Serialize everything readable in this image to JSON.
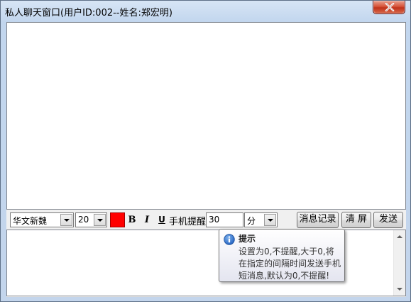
{
  "window": {
    "title": "私人聊天窗口(用户ID:002--姓名:郑宏明)",
    "close_icon": "close-icon"
  },
  "toolbar": {
    "font_family": "华文新魏",
    "font_size": "20",
    "text_color": "#ff0000",
    "bold_label": "B",
    "italic_label": "I",
    "underline_label": "U",
    "reminder_label": "手机提醒",
    "reminder_value": "30",
    "reminder_unit": "分",
    "history_button": "消息记录",
    "clear_button": "清 屏",
    "send_button": "发送"
  },
  "tooltip": {
    "icon": "info-icon",
    "title": "提示",
    "lines": [
      "设置为0,不提醒,大于0,将",
      "在指定的间隔时间发送手机",
      "短消息,默认为0,不提醒!"
    ]
  }
}
